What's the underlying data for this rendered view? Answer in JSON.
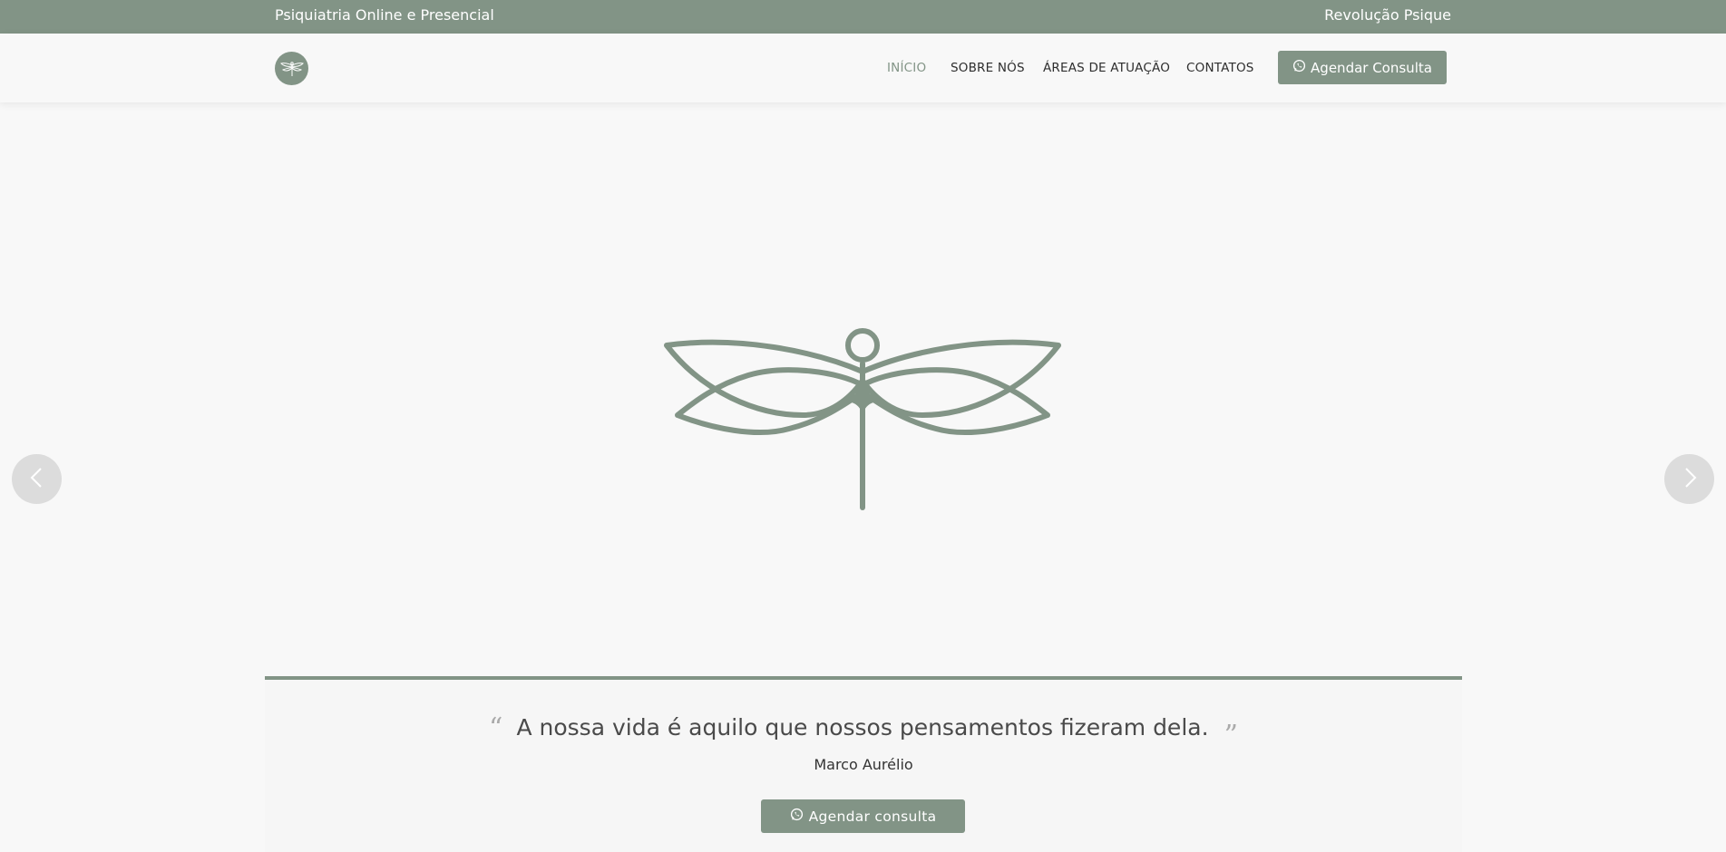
{
  "topbar": {
    "left_text": "Psiquiatria Online e Presencial",
    "right_text": "Revolução Psique"
  },
  "nav": {
    "logo_icon": "dragonfly-logo-icon",
    "items": [
      {
        "label": "INÍCIO",
        "active": true
      },
      {
        "label": "SOBRE NÓS",
        "active": false
      },
      {
        "label": "ÁREAS DE ATUAÇÃO",
        "active": false
      },
      {
        "label": "CONTATOS",
        "active": false
      }
    ],
    "cta_icon": "whatsapp-icon",
    "cta_label": "Agendar Consulta"
  },
  "hero": {
    "image_icon": "dragonfly-icon",
    "prev_icon": "chevron-left-icon",
    "next_icon": "chevron-right-icon"
  },
  "quote": {
    "open_mark": "“",
    "text": "A nossa vida é aquilo que nossos pensamentos fizeram dela.",
    "close_mark": "”",
    "author": "Marco Aurélio",
    "button_label": "Agendar consulta",
    "button_icon": "whatsapp-icon"
  },
  "colors": {
    "brand": "#829486",
    "background": "#f8f8f8",
    "arrow_bg": "#dcdcdc"
  }
}
